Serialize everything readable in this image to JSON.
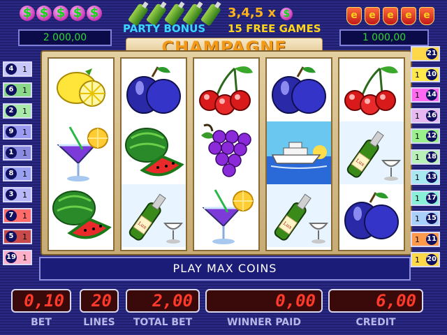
{
  "header": {
    "left_display": "2 000,00",
    "right_display": "1 000,00",
    "bonus_label": "PARTY BONUS",
    "free_games_multiplier": "3,4,5 x",
    "free_games_label": "15 FREE GAMES",
    "title": "CHAMPAGNE",
    "dollar_icons": [
      "$",
      "$",
      "$",
      "$",
      "$"
    ],
    "medal_icons": [
      "e",
      "e",
      "e",
      "e",
      "e"
    ]
  },
  "colors": {
    "accent_orange": "#f29a1a",
    "meter_red": "#ff3a2a",
    "bonus_cyan": "#3ad6ff",
    "display_green": "#2fd82f"
  },
  "reels": [
    [
      "lemon",
      "cocktail",
      "watermelon"
    ],
    [
      "plum",
      "watermelon",
      "champagne"
    ],
    [
      "cherries",
      "grapes",
      "cocktail"
    ],
    [
      "plum",
      "yacht",
      "champagne"
    ],
    [
      "cherries",
      "champagne",
      "plum"
    ]
  ],
  "lines_left": [
    {
      "num": "4",
      "bet": "1"
    },
    {
      "num": "6",
      "bet": "1"
    },
    {
      "num": "2",
      "bet": "1"
    },
    {
      "num": "9",
      "bet": "1"
    },
    {
      "num": "1",
      "bet": "1"
    },
    {
      "num": "8",
      "bet": "1"
    },
    {
      "num": "3",
      "bet": "1"
    },
    {
      "num": "7",
      "bet": "1"
    },
    {
      "num": "5",
      "bet": "1"
    },
    {
      "num": "19",
      "bet": "1"
    }
  ],
  "lines_right": [
    {
      "num": "21",
      "bet": ""
    },
    {
      "num": "10",
      "bet": "1"
    },
    {
      "num": "14",
      "bet": "1"
    },
    {
      "num": "16",
      "bet": "1"
    },
    {
      "num": "12",
      "bet": "1"
    },
    {
      "num": "18",
      "bet": "1"
    },
    {
      "num": "13",
      "bet": "1"
    },
    {
      "num": "17",
      "bet": "1"
    },
    {
      "num": "15",
      "bet": "1"
    },
    {
      "num": "11",
      "bet": "1"
    },
    {
      "num": "20",
      "bet": "1"
    }
  ],
  "message": "PLAY MAX COINS",
  "meters": {
    "bet": {
      "label": "BET",
      "value": "0,10"
    },
    "lines": {
      "label": "LINES",
      "value": "20"
    },
    "total_bet": {
      "label": "TOTAL BET",
      "value": "2,00"
    },
    "winner_paid": {
      "label": "WINNER PAID",
      "value": "0,00"
    },
    "credit": {
      "label": "CREDIT",
      "value": "6,00"
    }
  }
}
